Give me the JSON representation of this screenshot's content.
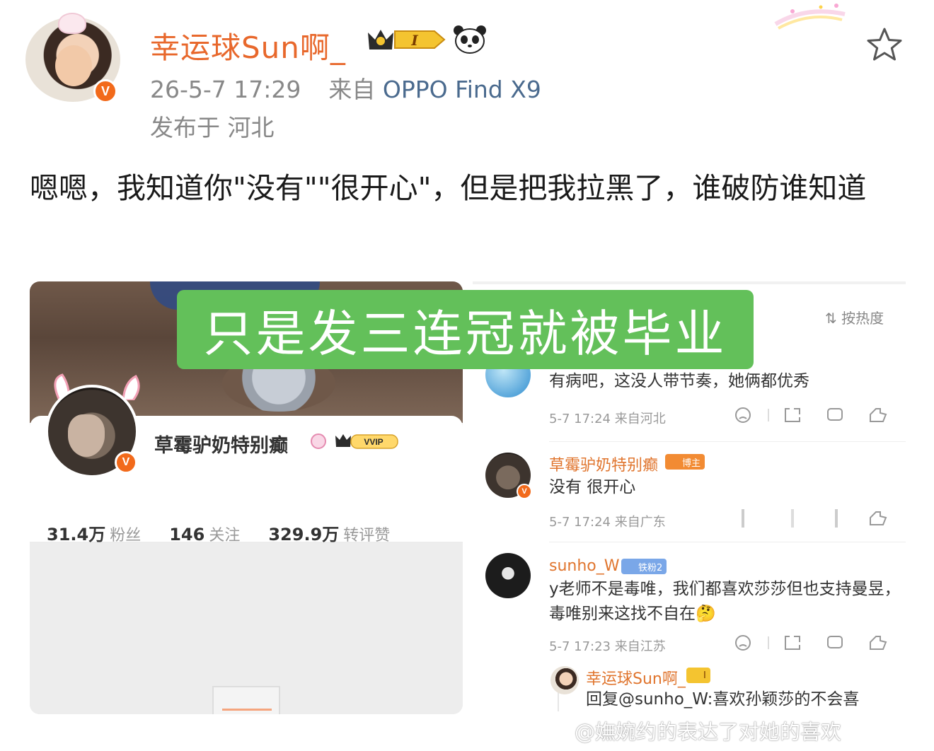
{
  "post": {
    "username": "幸运球Sun啊_",
    "timestamp": "26-5-7 17:29",
    "source_prefix": "来自",
    "device": "OPPO Find X9",
    "location": "发布于 河北",
    "text": "嗯嗯，我知道你\"没有\"\"很开心\"，但是把我拉黑了，谁破防谁知道",
    "verified_badge": "V",
    "crown_badge_level": "I"
  },
  "banner": {
    "text": "只是发三连冠就被毕业"
  },
  "left_screenshot": {
    "profile_name": "草霉驴奶特别癫",
    "vip_label": "VVIP",
    "verified_badge": "V",
    "stats": [
      {
        "value": "31.4万",
        "label": "粉丝"
      },
      {
        "value": "146",
        "label": "关注"
      },
      {
        "value": "329.9万",
        "label": "转评赞"
      }
    ]
  },
  "comments_panel": {
    "sort_label": "按热度",
    "comments": [
      {
        "name": "",
        "text": "有病吧，这没人带节奏，她俩都优秀",
        "meta": "5-7 17:24 来自河北"
      },
      {
        "name": "草霉驴奶特别癫",
        "badge": "博主",
        "text": "没有 很开心",
        "meta": "5-7 17:24 来自广东"
      },
      {
        "name": "sunho_W",
        "badge": "铁粉2",
        "text": "y老师不是毒唯，我们都喜欢莎莎但也支持曼昱，毒唯别来这找不自在🤔",
        "meta": "5-7 17:23 来自江苏"
      },
      {
        "name": "幸运球Sun啊_",
        "badge": "I",
        "text": "回复@sunho_W:喜欢孙颖莎的不会喜"
      }
    ]
  },
  "watermark": "@嫵婉约的表达了对她的喜欢",
  "icons": {
    "favorite": "star-outline-icon",
    "panda": "panda-icon",
    "emoji_react": "emoji-icon",
    "share": "share-icon",
    "comment": "comment-icon",
    "like": "thumbs-up-icon",
    "sort": "sort-icon"
  },
  "colors": {
    "username": "#e8682c",
    "device_link": "#4a6a8e",
    "banner_bg": "#63c05a",
    "verified": "#f26a1b"
  }
}
